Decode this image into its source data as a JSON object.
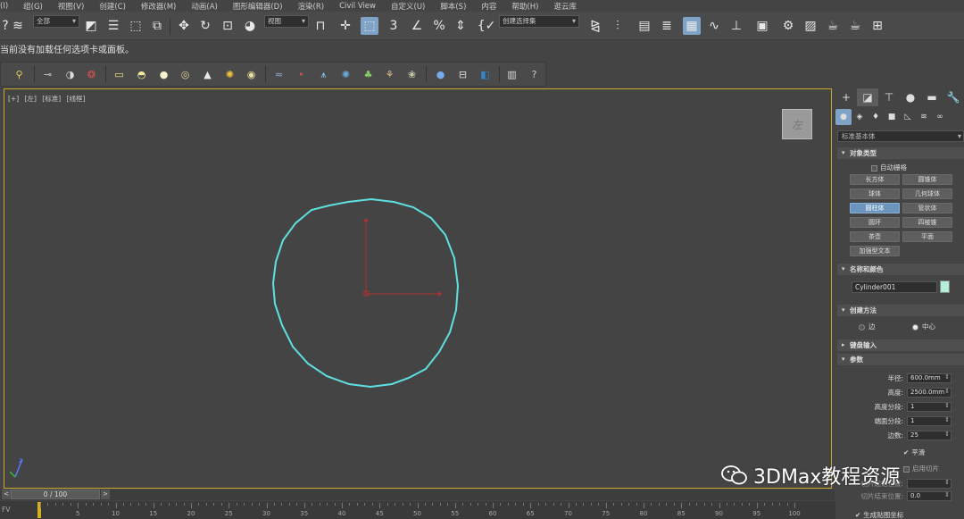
{
  "menu": [
    "(I)",
    "组(G)",
    "视图(V)",
    "创建(C)",
    "修改器(M)",
    "动画(A)",
    "图形编辑器(D)",
    "渲染(R)",
    "Civil View",
    "自定义(U)",
    "脚本(S)",
    "内容",
    "帮助(H)",
    "逛云库"
  ],
  "toolbar": {
    "selection_filter": "全部",
    "reference_coord": "视图",
    "named_selection": "创建选择集",
    "snap_label": "3"
  },
  "notice": "当前没有加载任何选项卡或面板。",
  "viewport": {
    "labels": [
      "[+]",
      "[左]",
      "[标准]",
      "[线框]"
    ],
    "viewcube": "左",
    "object_color": "#5fe0e0",
    "border_color": "#c9a82a"
  },
  "command_panel": {
    "category": "标准基本体",
    "object_type": {
      "title": "对象类型",
      "autogrid": "自动栅格",
      "buttons": [
        "长方体",
        "圆锥体",
        "球体",
        "几何球体",
        "圆柱体",
        "管状体",
        "圆环",
        "四棱锥",
        "茶壶",
        "平面",
        "加强型文本"
      ],
      "selected": "圆柱体"
    },
    "name_color": {
      "title": "名称和颜色",
      "name": "Cylinder001",
      "color": "#b3f0d8"
    },
    "creation_method": {
      "title": "创建方法",
      "options": [
        "边",
        "中心"
      ],
      "selected": "中心"
    },
    "keyboard_entry": "键盘输入",
    "parameters": {
      "title": "参数",
      "rows": [
        {
          "label": "半径:",
          "value": "600.0mm"
        },
        {
          "label": "高度:",
          "value": "2500.0mm"
        },
        {
          "label": "高度分段:",
          "value": "1"
        },
        {
          "label": "端面分段:",
          "value": "1"
        },
        {
          "label": "边数:",
          "value": "25"
        }
      ],
      "smooth": "平滑",
      "slice_on": "启用切片",
      "slice_from": "切片起始位置:",
      "slice_to": "切片结束位置:",
      "slice_to_value": "0.0",
      "gen_map": "生成贴图坐标"
    }
  },
  "timeline": {
    "frame": "0 / 100",
    "ticks": [
      "5",
      "10",
      "15",
      "20",
      "25",
      "30",
      "35",
      "40",
      "45",
      "50",
      "55",
      "60",
      "65",
      "70",
      "75",
      "80",
      "85",
      "90",
      "95",
      "100"
    ],
    "fv": "FV"
  },
  "watermark": "3DMax教程资源"
}
